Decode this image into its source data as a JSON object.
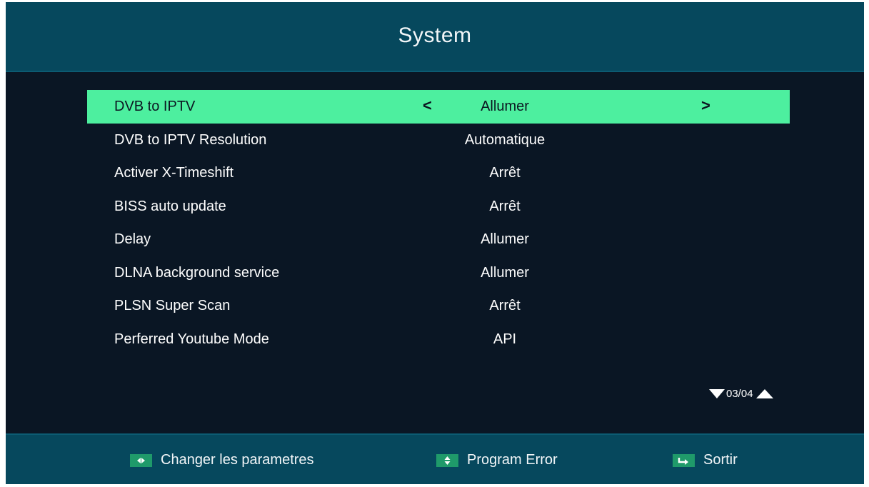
{
  "header": {
    "title": "System"
  },
  "menu": {
    "items": [
      {
        "label": "DVB to IPTV",
        "value": "Allumer"
      },
      {
        "label": "DVB to IPTV Resolution",
        "value": "Automatique"
      },
      {
        "label": "Activer X-Timeshift",
        "value": "Arrêt"
      },
      {
        "label": "BISS auto update",
        "value": "Arrêt"
      },
      {
        "label": "Delay",
        "value": "Allumer"
      },
      {
        "label": "DLNA background service",
        "value": "Allumer"
      },
      {
        "label": "PLSN Super Scan",
        "value": "Arrêt"
      },
      {
        "label": "Perferred Youtube Mode",
        "value": "API"
      }
    ],
    "selected_index": 0,
    "prev_glyph": "<",
    "next_glyph": ">"
  },
  "pager": {
    "text": "03/04"
  },
  "footer": {
    "hints": [
      {
        "icon": "left-right-icon",
        "label": "Changer les parametres"
      },
      {
        "icon": "up-down-icon",
        "label": "Program Error"
      },
      {
        "icon": "exit-icon",
        "label": "Sortir"
      }
    ]
  },
  "colors": {
    "header_bg": "#06485d",
    "body_bg": "#0a1624",
    "highlight": "#4def9f",
    "key_bg": "#1f9a6a"
  }
}
